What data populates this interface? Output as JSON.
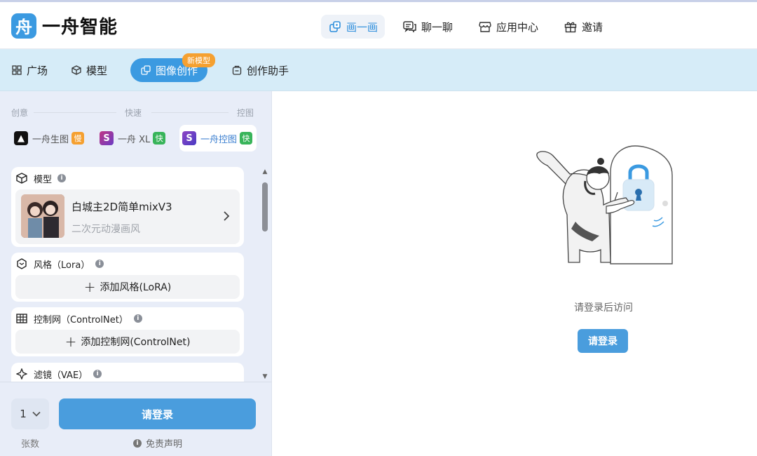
{
  "brand": {
    "logo_glyph": "舟",
    "name": "一舟智能",
    "accent": "#3b9ae1"
  },
  "topnav": [
    {
      "label": "画一画",
      "icon": "draw-icon",
      "active": true
    },
    {
      "label": "聊一聊",
      "icon": "chat-icon",
      "active": false
    },
    {
      "label": "应用中心",
      "icon": "store-icon",
      "active": false
    },
    {
      "label": "邀请",
      "icon": "gift-icon",
      "active": false
    }
  ],
  "subnav": [
    {
      "label": "广场",
      "icon": "grid-icon"
    },
    {
      "label": "模型",
      "icon": "cube-icon"
    },
    {
      "label": "图像创作",
      "icon": "image-create-icon",
      "active": true,
      "badge": "新模型"
    },
    {
      "label": "创作助手",
      "icon": "assistant-icon"
    }
  ],
  "modes": {
    "left": "创意",
    "middle": "快速",
    "right": "控图"
  },
  "model_tabs": [
    {
      "label": "一舟生图",
      "icon_glyph": "▲",
      "icon_color": "#111111",
      "tag": "慢",
      "tag_color": "#f5a030"
    },
    {
      "label": "一舟 XL",
      "icon_glyph": "S",
      "icon_color": "#8e44c4",
      "tag": "快",
      "tag_color": "#38b45a"
    },
    {
      "label": "一舟控图",
      "icon_glyph": "S",
      "icon_color": "#6a3cc4",
      "tag": "快",
      "tag_color": "#38b45a",
      "active": true
    }
  ],
  "model_card": {
    "title": "模型",
    "info": "i",
    "name": "白城主2D简单mixV3",
    "subtitle": "二次元动漫画风"
  },
  "lora_card": {
    "title": "风格（Lora）",
    "info": "i",
    "plus": "+",
    "button": "添加风格(LoRA)"
  },
  "controlnet_card": {
    "title": "控制网（ControlNet）",
    "info": "i",
    "plus": "+",
    "button": "添加控制网(ControlNet)"
  },
  "vae_card": {
    "title": "滤镜（VAE）",
    "info": "i"
  },
  "footer": {
    "count_value": "1",
    "count_label": "张数",
    "login_button": "请登录",
    "disclaimer_icon": "i",
    "disclaimer": "免责声明"
  },
  "right": {
    "hint": "请登录后访问",
    "login_button": "请登录"
  }
}
